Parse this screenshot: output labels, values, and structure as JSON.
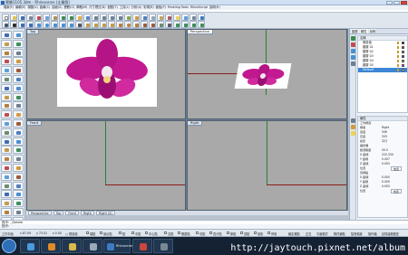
{
  "window": {
    "title": "實驗1105.3dm - Rhinoceros (企業版)"
  },
  "menu": [
    "檔案(F)",
    "編輯(E)",
    "視圖(V)",
    "曲線(C)",
    "曲面(S)",
    "實體(O)",
    "網格(M)",
    "尺寸標註(D)",
    "變動(T)",
    "工具(L)",
    "分析(A)",
    "彩現(R)",
    "面板(P)",
    "Paneling Tools",
    "RhinoScript",
    "說明(H)"
  ],
  "viewports": {
    "top": "Top",
    "perspective": "Perspective",
    "front": "Front",
    "right": "Right"
  },
  "viewport_tabs": [
    "Perspective",
    "Top",
    "Front",
    "Right",
    "Right (4)"
  ],
  "right_panel": {
    "tabs": [
      "圖層",
      "屬性",
      "說明"
    ],
    "layers_header": "名稱",
    "layers": [
      "預設值",
      "圖層 01",
      "圖層 02",
      "圖層 03",
      "圖層 04",
      "圖層 05",
      "Default"
    ],
    "props_header": "屬性",
    "props_title": "工作視窗",
    "props": [
      {
        "label": "標題",
        "value": "Right"
      },
      {
        "label": "寬度",
        "value": "506"
      },
      {
        "label": "高度",
        "value": "203"
      },
      {
        "label": "投影",
        "value": "平行"
      },
      {
        "label": "攝影機",
        "value": ""
      },
      {
        "label": "鏡頭焦距",
        "value": "50.0"
      },
      {
        "label": "X 座標",
        "value": "220.334"
      },
      {
        "label": "Y 座標",
        "value": "0.007"
      },
      {
        "label": "Z 座標",
        "value": "0.003"
      },
      {
        "label": "位置",
        "value": "放置"
      },
      {
        "label": "目標點",
        "value": ""
      },
      {
        "label": "X 座標",
        "value": "0.000"
      },
      {
        "label": "Y 座標",
        "value": "0.000"
      },
      {
        "label": "Z 座標",
        "value": "0.003"
      },
      {
        "label": "位置",
        "value": "放置"
      }
    ]
  },
  "command": {
    "prompt": "指令: _Delete",
    "prompt2": "指令:"
  },
  "status": {
    "plane": "工作平面",
    "x": "x 87.09",
    "y": "y 73.01",
    "z": "z 0.00",
    "color_label": "□ 預設值",
    "snaps": [
      "端點",
      "最近點",
      "點",
      "中點",
      "中心點",
      "交點",
      "垂直點",
      "切點",
      "四分點",
      "節點",
      "頂點",
      "投影",
      "停用"
    ],
    "modes": [
      "鎖定格點",
      "正交",
      "平面模式",
      "物件鎖點",
      "智慧軌跡",
      "操作軸",
      "記錄建構歷史"
    ]
  },
  "taskbar": {
    "items": [
      "Explorer",
      "Media",
      "Folder",
      "Rhino",
      "Rhinoceros Photosh...",
      "Paint",
      "Rhino 5"
    ],
    "watermark": "http://jaytouch.pixnet.net/album"
  }
}
